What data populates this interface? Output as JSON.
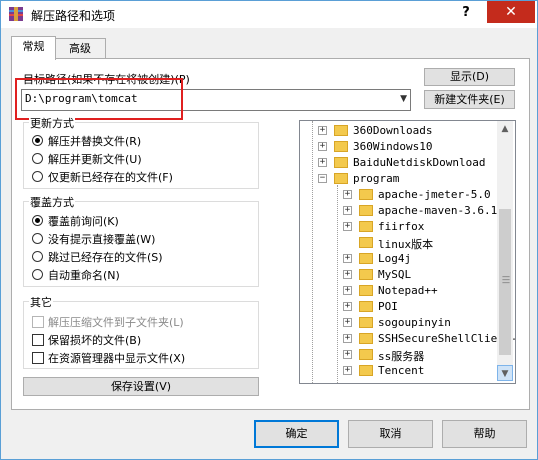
{
  "window": {
    "title": "解压路径和选项",
    "help_symbol": "?",
    "close_symbol": "✕"
  },
  "tabs": [
    {
      "label": "常规"
    },
    {
      "label": "高级"
    }
  ],
  "destination": {
    "label": "目标路径(如果不存在将被创建)(P)",
    "value": "D:\\program\\tomcat",
    "show_button": "显示(D)",
    "new_folder_button": "新建文件夹(E)"
  },
  "update_mode": {
    "title": "更新方式",
    "options": [
      "解压并替换文件(R)",
      "解压并更新文件(U)",
      "仅更新已经存在的文件(F)"
    ],
    "selected": 0
  },
  "overwrite_mode": {
    "title": "覆盖方式",
    "options": [
      "覆盖前询问(K)",
      "没有提示直接覆盖(W)",
      "跳过已经存在的文件(S)",
      "自动重命名(N)"
    ],
    "selected": 0
  },
  "misc": {
    "title": "其它",
    "options": [
      {
        "label": "解压压缩文件到子文件夹(L)",
        "checked": false,
        "disabled": true
      },
      {
        "label": "保留损坏的文件(B)",
        "checked": false,
        "disabled": false
      },
      {
        "label": "在资源管理器中显示文件(X)",
        "checked": false,
        "disabled": false
      }
    ]
  },
  "save_settings_button": "保存设置(V)",
  "folder_tree": {
    "items": [
      {
        "label": "360Downloads",
        "expander": "+",
        "level": 0
      },
      {
        "label": "360Windows10",
        "expander": "+",
        "level": 0
      },
      {
        "label": "BaiduNetdiskDownload",
        "expander": "+",
        "level": 0
      },
      {
        "label": "program",
        "expander": "−",
        "level": 0
      },
      {
        "label": "apache-jmeter-5.0",
        "expander": "+",
        "level": 1
      },
      {
        "label": "apache-maven-3.6.1",
        "expander": "+",
        "level": 1
      },
      {
        "label": "fiirfox",
        "expander": "+",
        "level": 1
      },
      {
        "label": "linux版本",
        "expander": "",
        "level": 1
      },
      {
        "label": "Log4j",
        "expander": "+",
        "level": 1
      },
      {
        "label": "MySQL",
        "expander": "+",
        "level": 1
      },
      {
        "label": "Notepad++",
        "expander": "+",
        "level": 1
      },
      {
        "label": "POI",
        "expander": "+",
        "level": 1
      },
      {
        "label": "sogoupinyin",
        "expander": "+",
        "level": 1
      },
      {
        "label": "SSHSecureShellClient-",
        "expander": "+",
        "level": 1
      },
      {
        "label": "ss服务器",
        "expander": "+",
        "level": 1
      },
      {
        "label": "Tencent",
        "expander": "+",
        "level": 1
      }
    ]
  },
  "footer": {
    "ok": "确定",
    "cancel": "取消",
    "help": "帮助"
  },
  "colors": {
    "highlight": "#e02020",
    "close_bg": "#c42b1c",
    "accent": "#0078d7",
    "folder": "#f3c94d"
  }
}
